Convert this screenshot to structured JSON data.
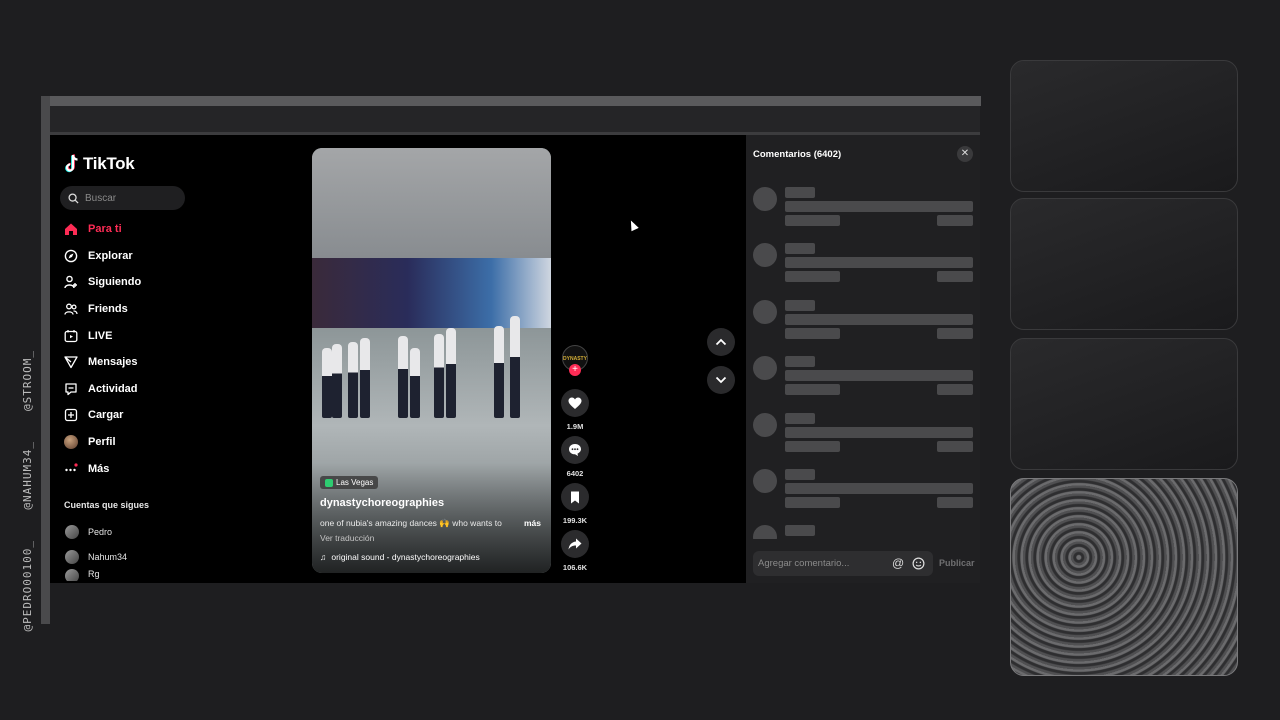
{
  "handles": [
    "@STROOM_",
    "@NAHUM34_",
    "@PEDRO00100_"
  ],
  "app": {
    "logo_text": "TikTok",
    "search_placeholder": "Buscar",
    "nav": [
      {
        "label": "Para ti",
        "icon": "home-icon",
        "active": true
      },
      {
        "label": "Explorar",
        "icon": "compass-icon"
      },
      {
        "label": "Siguiendo",
        "icon": "user-follow-icon"
      },
      {
        "label": "Friends",
        "icon": "friends-icon"
      },
      {
        "label": "LIVE",
        "icon": "live-icon"
      },
      {
        "label": "Mensajes",
        "icon": "send-icon"
      },
      {
        "label": "Actividad",
        "icon": "activity-icon"
      },
      {
        "label": "Cargar",
        "icon": "upload-icon"
      },
      {
        "label": "Perfil",
        "icon": "profile-avatar"
      },
      {
        "label": "Más",
        "icon": "more-icon"
      }
    ],
    "following_title": "Cuentas que sigues",
    "following": [
      "Pedro",
      "Nahum34",
      "Rg"
    ]
  },
  "video": {
    "location": "Las Vegas",
    "author": "dynastychoreographies",
    "description": "one of nubia's amazing dances 🙌 who wants to",
    "more_label": "más",
    "translate_label": "Ver traducción",
    "sound": "original sound - dynastychoreographies",
    "avatar_text": "DYNASTY",
    "likes": "1.9M",
    "comments": "6402",
    "saves": "199.3K",
    "shares": "106.6K"
  },
  "comments_panel": {
    "title": "Comentarios (6402)",
    "input_placeholder": "Agregar comentario...",
    "at_symbol": "@",
    "post_label": "Publicar",
    "skeleton_rows": 7
  }
}
